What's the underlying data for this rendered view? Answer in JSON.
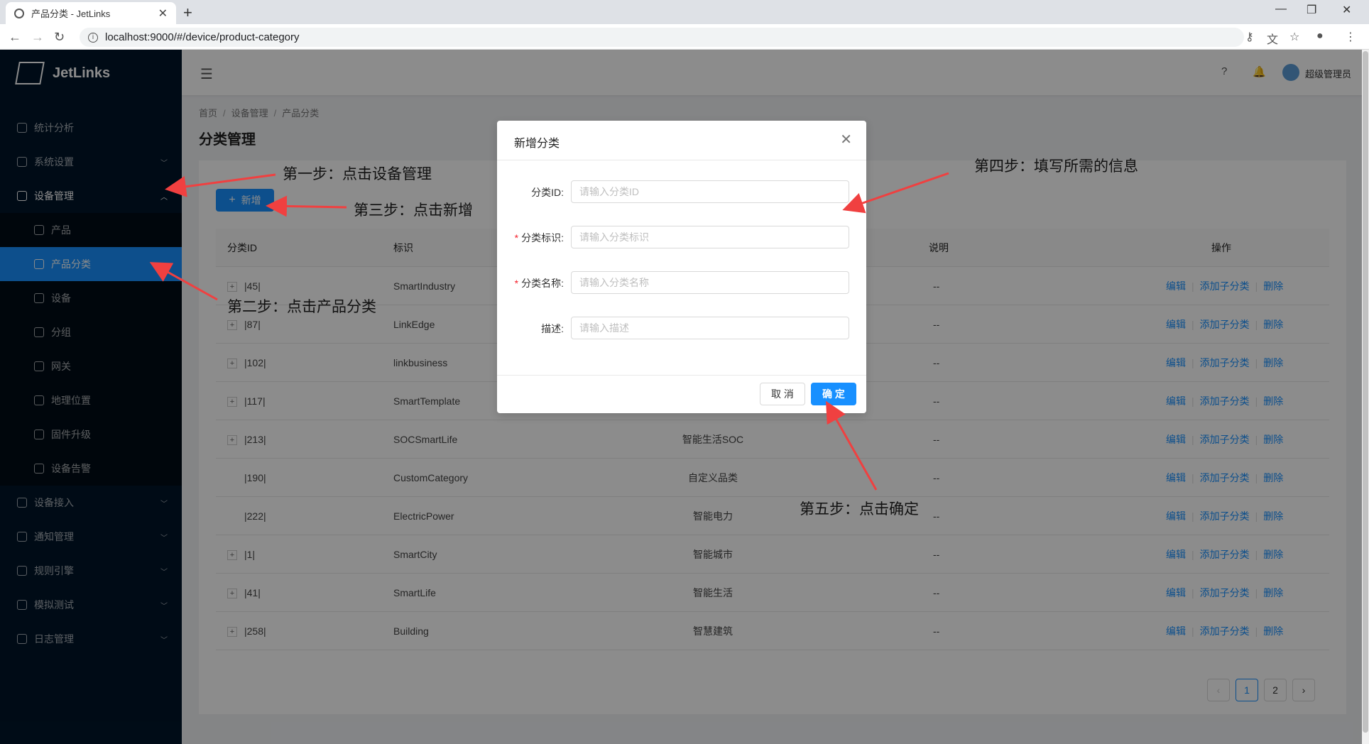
{
  "browser": {
    "tab_title": "产品分类 - JetLinks",
    "url": "localhost:9000/#/device/product-category",
    "newtab": "+",
    "close": "✕"
  },
  "sidebar": {
    "logo_text": "JetLinks",
    "items": [
      {
        "label": "统计分析"
      },
      {
        "label": "系统设置"
      },
      {
        "label": "设备管理"
      },
      {
        "label": "设备接入"
      },
      {
        "label": "通知管理"
      },
      {
        "label": "规则引擎"
      },
      {
        "label": "模拟测试"
      },
      {
        "label": "日志管理"
      }
    ],
    "sub_items": [
      {
        "label": "产品"
      },
      {
        "label": "产品分类"
      },
      {
        "label": "设备"
      },
      {
        "label": "分组"
      },
      {
        "label": "网关"
      },
      {
        "label": "地理位置"
      },
      {
        "label": "固件升级"
      },
      {
        "label": "设备告警"
      }
    ]
  },
  "header": {
    "username": "超级管理员"
  },
  "breadcrumb": [
    "首页",
    "设备管理",
    "产品分类"
  ],
  "page_title": "分类管理",
  "toolbar": {
    "add_label": "新增"
  },
  "table": {
    "headers": {
      "id": "分类ID",
      "key": "标识",
      "desc": "说明",
      "ops": "操作"
    },
    "rows": [
      {
        "expand": true,
        "id": "|45|",
        "key": "SmartIndustry",
        "name": "",
        "desc": "--"
      },
      {
        "expand": true,
        "id": "|87|",
        "key": "LinkEdge",
        "name": "",
        "desc": "--"
      },
      {
        "expand": true,
        "id": "|102|",
        "key": "linkbusiness",
        "name": "",
        "desc": "--"
      },
      {
        "expand": true,
        "id": "|117|",
        "key": "SmartTemplate",
        "name": "",
        "desc": "--"
      },
      {
        "expand": true,
        "id": "|213|",
        "key": "SOCSmartLife",
        "name": "智能生活SOC",
        "desc": "--"
      },
      {
        "expand": false,
        "id": "|190|",
        "key": "CustomCategory",
        "name": "自定义品类",
        "desc": "--"
      },
      {
        "expand": false,
        "id": "|222|",
        "key": "ElectricPower",
        "name": "智能电力",
        "desc": "--"
      },
      {
        "expand": true,
        "id": "|1|",
        "key": "SmartCity",
        "name": "智能城市",
        "desc": "--"
      },
      {
        "expand": true,
        "id": "|41|",
        "key": "SmartLife",
        "name": "智能生活",
        "desc": "--"
      },
      {
        "expand": true,
        "id": "|258|",
        "key": "Building",
        "name": "智慧建筑",
        "desc": "--"
      }
    ],
    "ops": {
      "edit": "编辑",
      "add_child": "添加子分类",
      "delete": "删除"
    }
  },
  "pagination": {
    "prev": "‹",
    "pages": [
      "1",
      "2"
    ],
    "next": "›",
    "current": "1"
  },
  "modal": {
    "title": "新增分类",
    "fields": [
      {
        "label": "分类ID:",
        "placeholder": "请输入分类ID",
        "required": false
      },
      {
        "label": "分类标识:",
        "placeholder": "请输入分类标识",
        "required": true
      },
      {
        "label": "分类名称:",
        "placeholder": "请输入分类名称",
        "required": true
      },
      {
        "label": "描述:",
        "placeholder": "请输入描述",
        "required": false
      }
    ],
    "cancel": "取 消",
    "ok": "确 定"
  },
  "annotations": {
    "step1": "第一步：点击设备管理",
    "step2": "第二步：点击产品分类",
    "step3": "第三步：点击新增",
    "step4": "第四步：填写所需的信息",
    "step5": "第五步：点击确定"
  },
  "colors": {
    "primary": "#1890ff",
    "sidebar": "#001529",
    "arrow": "#f04040"
  }
}
